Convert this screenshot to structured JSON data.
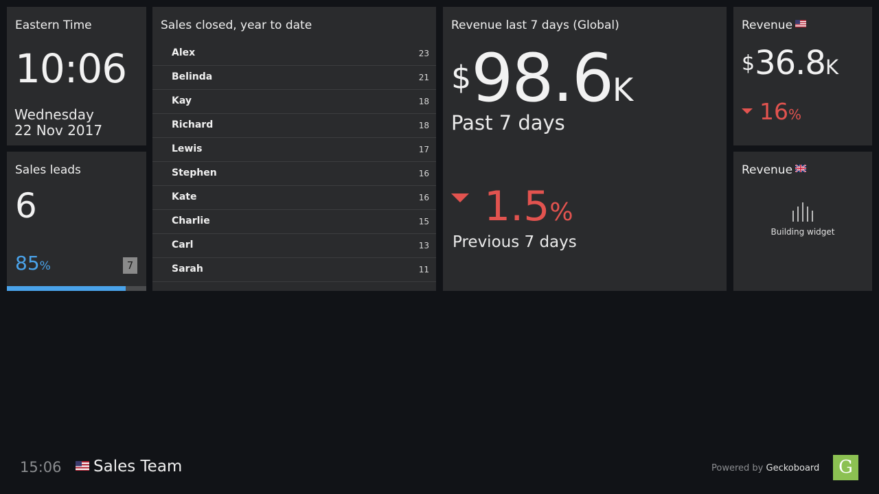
{
  "clock": {
    "title": "Eastern Time",
    "time": "10:06",
    "day": "Wednesday",
    "date": "22 Nov 2017"
  },
  "leads": {
    "title": "Sales leads",
    "value": "6",
    "percent": "85",
    "percent_unit": "%",
    "goal": "7",
    "progress_fraction": 0.85,
    "accent_color": "#4aa3ea"
  },
  "leaderboard": {
    "title": "Sales closed, year to date",
    "rows": [
      {
        "name": "Alex",
        "value": "23"
      },
      {
        "name": "Belinda",
        "value": "21"
      },
      {
        "name": "Kay",
        "value": "18"
      },
      {
        "name": "Richard",
        "value": "18"
      },
      {
        "name": "Lewis",
        "value": "17"
      },
      {
        "name": "Stephen",
        "value": "16"
      },
      {
        "name": "Kate",
        "value": "16"
      },
      {
        "name": "Charlie",
        "value": "15"
      },
      {
        "name": "Carl",
        "value": "13"
      },
      {
        "name": "Sarah",
        "value": "11"
      }
    ]
  },
  "revenue_global": {
    "title": "Revenue last 7 days (Global)",
    "currency": "$",
    "value": "98.6",
    "suffix": "K",
    "label": "Past 7 days",
    "change": "1.5",
    "change_unit": "%",
    "change_direction": "down",
    "comparison_label": "Previous 7 days",
    "negative_color": "#e2534f"
  },
  "revenue_us": {
    "title": "Revenue",
    "flag": "us-flag-icon",
    "currency": "$",
    "value": "36.8",
    "suffix": "K",
    "change": "16",
    "change_unit": "%",
    "change_direction": "down"
  },
  "revenue_uk": {
    "title": "Revenue",
    "flag": "uk-flag-icon",
    "status": "Building widget"
  },
  "footer": {
    "time": "15:06",
    "flag": "us-flag-icon",
    "dashboard_name": "Sales Team",
    "powered_by": "Powered by",
    "brand": "Geckoboard",
    "logo_letter": "G",
    "logo_color": "#8cc152"
  }
}
